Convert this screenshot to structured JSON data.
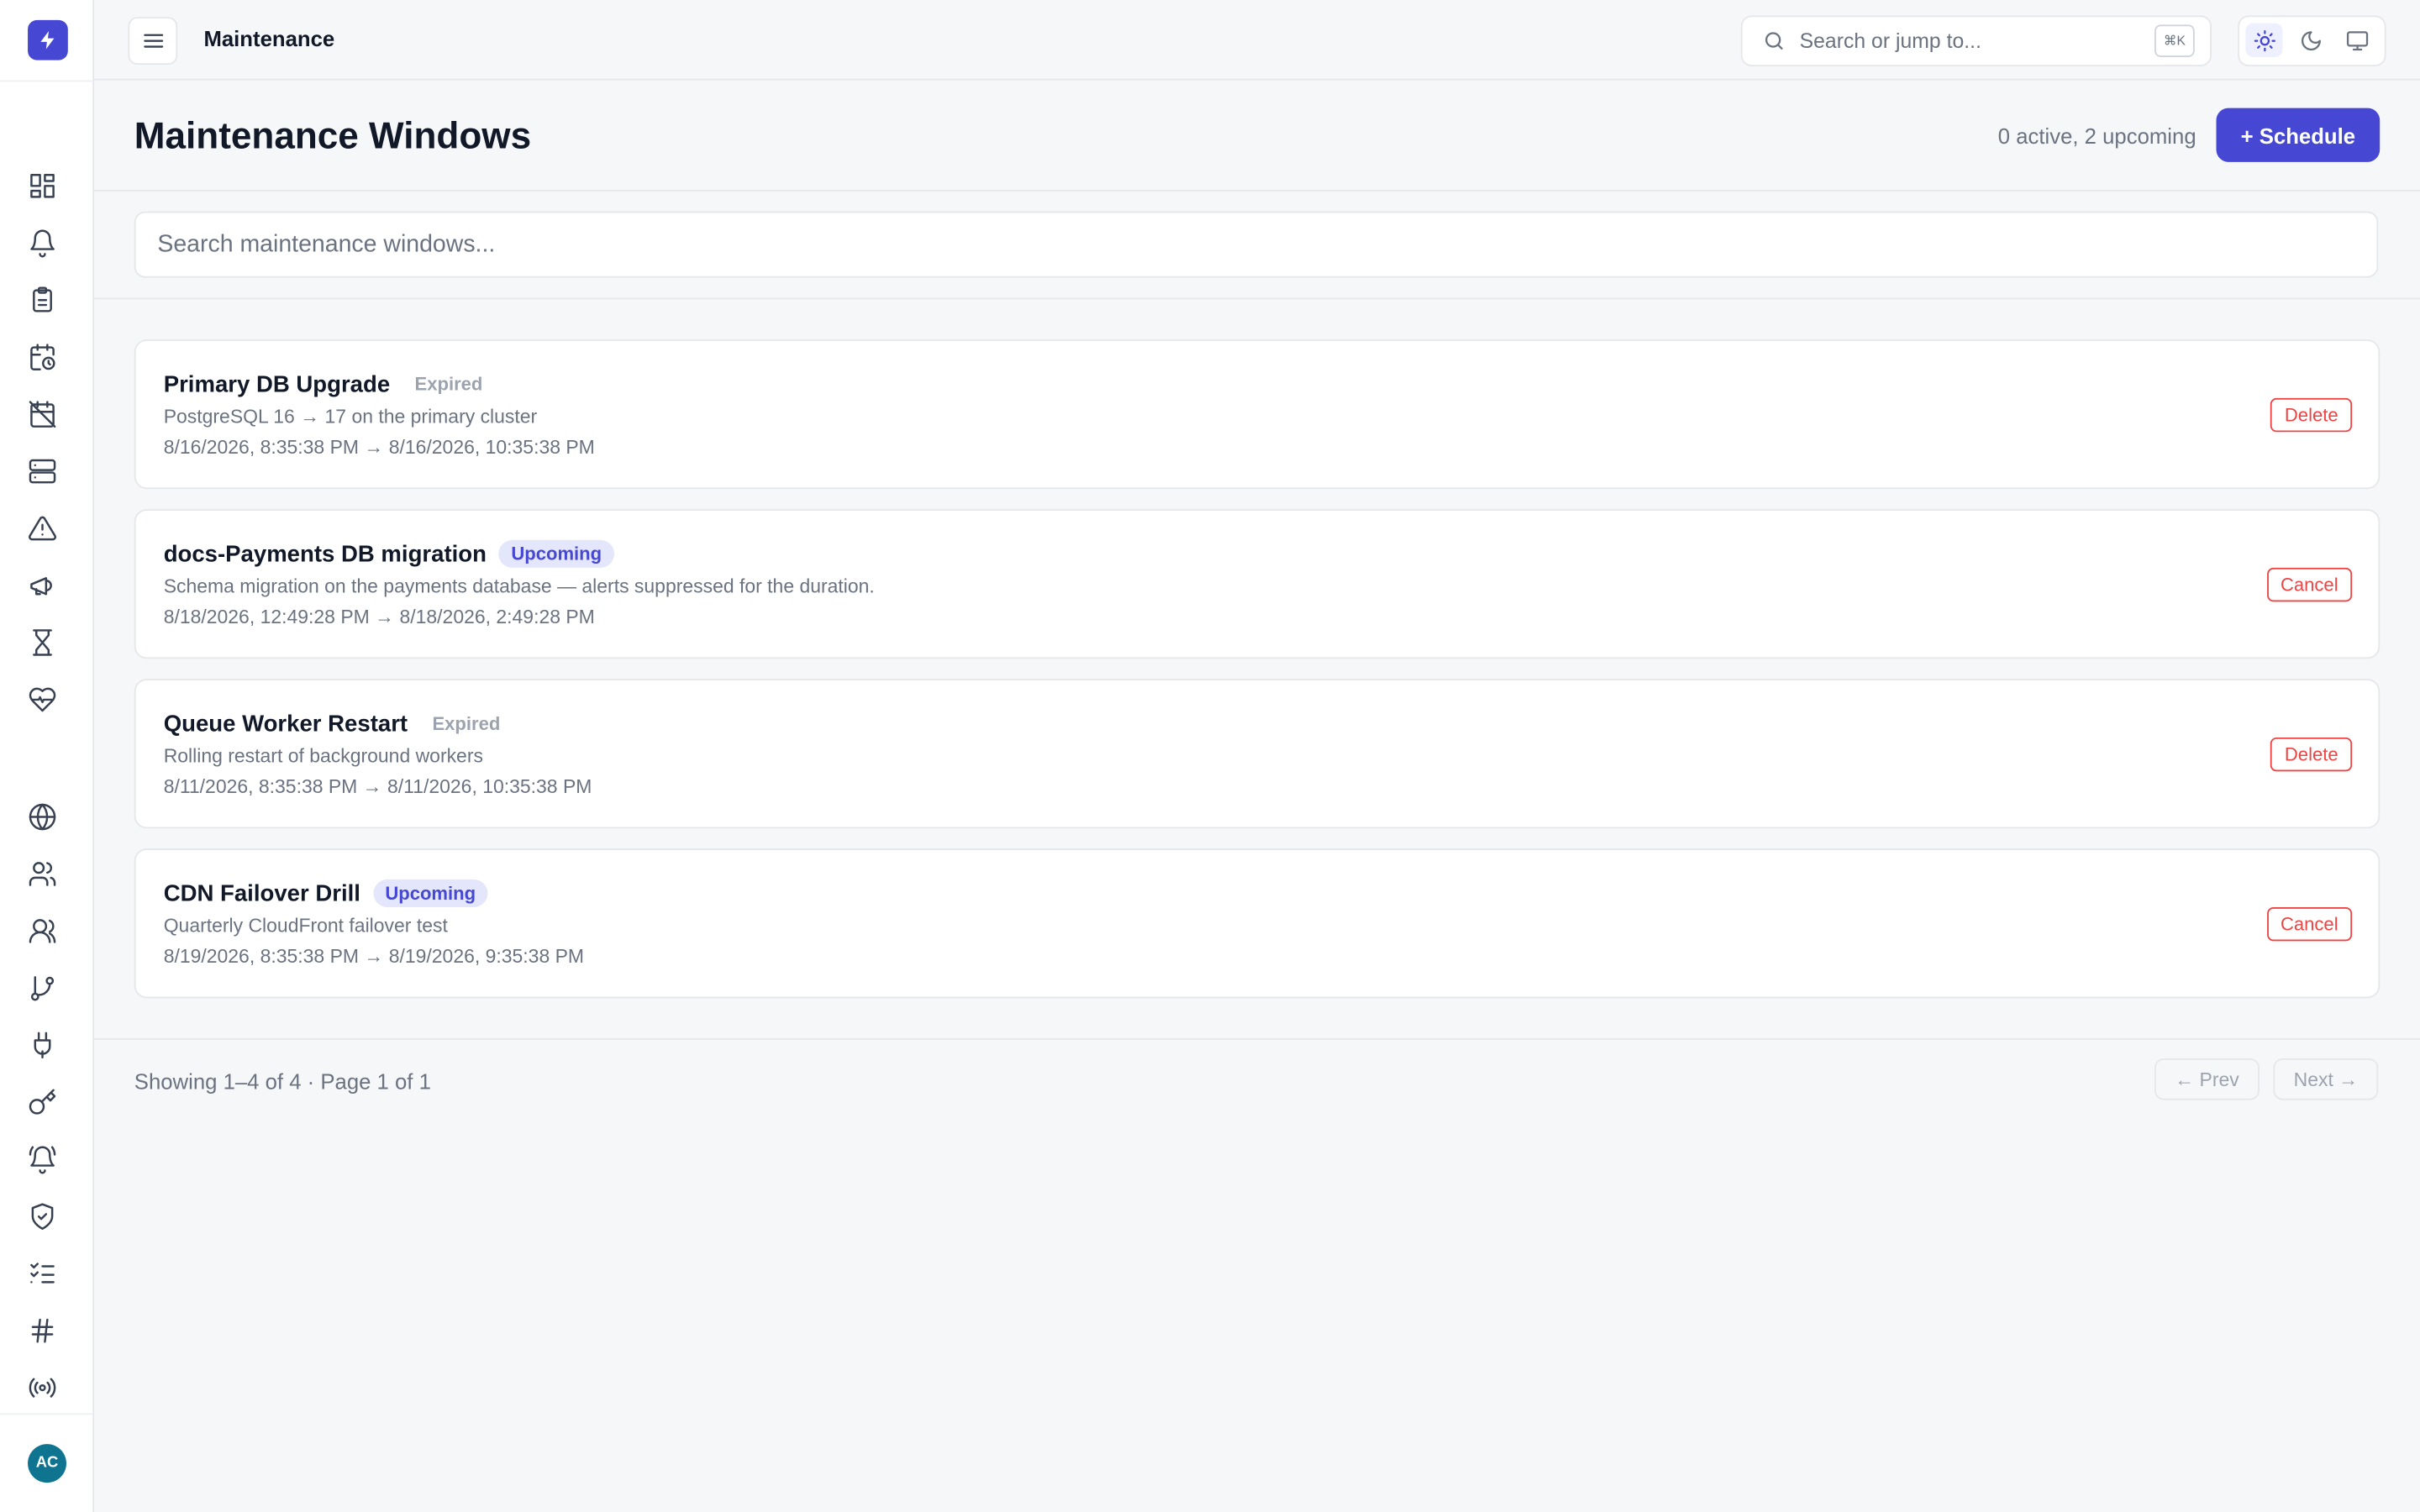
{
  "topbar": {
    "breadcrumb": "Maintenance",
    "search_placeholder": "Search or jump to...",
    "shortcut": "⌘K"
  },
  "sidebar": {
    "logo": "bolt-icon",
    "items": [
      "dashboard-icon",
      "bell-icon",
      "clipboard-icon",
      "calendar-clock-icon",
      "calendar-off-icon",
      "server-icon",
      "alert-triangle-icon",
      "megaphone-icon",
      "hourglass-icon",
      "heart-pulse-icon",
      "globe-icon",
      "users-icon",
      "team-icon",
      "git-branch-icon",
      "plug-icon",
      "key-icon",
      "bell-ring-icon",
      "shield-check-icon",
      "list-checks-icon",
      "hash-icon",
      "radio-icon"
    ],
    "avatar": "AC"
  },
  "header": {
    "title": "Maintenance Windows",
    "summary": "0 active, 2 upcoming",
    "schedule_label": "+ Schedule"
  },
  "filter": {
    "placeholder": "Search maintenance windows..."
  },
  "windows": [
    {
      "name": "Primary DB Upgrade",
      "status": "Expired",
      "description": "PostgreSQL 16 → 17 on the primary cluster",
      "time": "8/16/2026, 8:35:38 PM → 8/16/2026, 10:35:38 PM",
      "action": "Delete"
    },
    {
      "name": "docs-Payments DB migration",
      "status": "Upcoming",
      "description": "Schema migration on the payments database — alerts suppressed for the duration.",
      "time": "8/18/2026, 12:49:28 PM → 8/18/2026, 2:49:28 PM",
      "action": "Cancel"
    },
    {
      "name": "Queue Worker Restart",
      "status": "Expired",
      "description": "Rolling restart of background workers",
      "time": "8/11/2026, 8:35:38 PM → 8/11/2026, 10:35:38 PM",
      "action": "Delete"
    },
    {
      "name": "CDN Failover Drill",
      "status": "Upcoming",
      "description": "Quarterly CloudFront failover test",
      "time": "8/19/2026, 8:35:38 PM → 8/19/2026, 9:35:38 PM",
      "action": "Cancel"
    }
  ],
  "pagination": {
    "showing": "Showing 1–4 of 4 · Page 1 of 1",
    "prev": "← Prev",
    "next": "Next →"
  },
  "colors": {
    "accent": "#4648d4",
    "danger": "#ef4444"
  }
}
